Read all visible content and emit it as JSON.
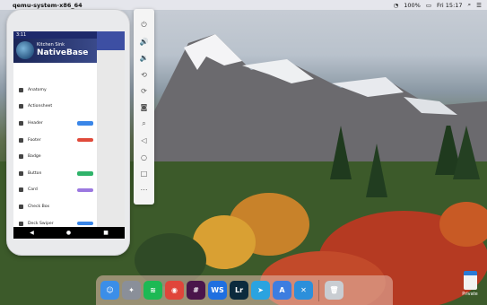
{
  "menubar": {
    "app_name": "qemu-system-x86_64",
    "battery": "100%",
    "time": "Fri 15:17"
  },
  "phone": {
    "status_time": "3:11",
    "header_small": "Kitchen Sink",
    "header_title": "NativeBase",
    "items": [
      {
        "label": "Anatomy",
        "badge": ""
      },
      {
        "label": "Actionsheet",
        "badge": ""
      },
      {
        "label": "Header",
        "badge": "#3a86e8"
      },
      {
        "label": "Footer",
        "badge": "#e04a3a"
      },
      {
        "label": "Badge",
        "badge": ""
      },
      {
        "label": "Button",
        "badge": "#2fb36a"
      },
      {
        "label": "Card",
        "badge": "#9b78e0"
      },
      {
        "label": "Check Box",
        "badge": ""
      },
      {
        "label": "Deck Swiper",
        "badge": "#3a86e8"
      }
    ]
  },
  "toolbar": {
    "icons": [
      "power-icon",
      "volume-up-icon",
      "volume-down-icon",
      "rotate-left-icon",
      "rotate-right-icon",
      "camera-icon",
      "zoom-icon",
      "back-icon",
      "home-icon",
      "overview-icon",
      "more-icon"
    ]
  },
  "dock": {
    "apps": [
      {
        "name": "finder",
        "color": "#3b8ee8",
        "glyph": "☺"
      },
      {
        "name": "launchpad",
        "color": "#8a8f99",
        "glyph": "✦"
      },
      {
        "name": "spotify",
        "color": "#1db954",
        "glyph": "≋"
      },
      {
        "name": "chrome",
        "color": "#e0453a",
        "glyph": "◉"
      },
      {
        "name": "slack",
        "color": "#4a154b",
        "glyph": "#"
      },
      {
        "name": "webstorm",
        "color": "#1f6fe0",
        "glyph": "WS"
      },
      {
        "name": "lightroom",
        "color": "#0b2a3d",
        "glyph": "Lr"
      },
      {
        "name": "telegram",
        "color": "#2aa3e0",
        "glyph": "➤"
      },
      {
        "name": "android-studio",
        "color": "#3d7de0",
        "glyph": "A"
      },
      {
        "name": "xcode",
        "color": "#2c8fdb",
        "glyph": "✕"
      },
      {
        "name": "trash",
        "color": "#c9cdd2",
        "glyph": "🗑"
      }
    ],
    "private_label": "Private"
  }
}
